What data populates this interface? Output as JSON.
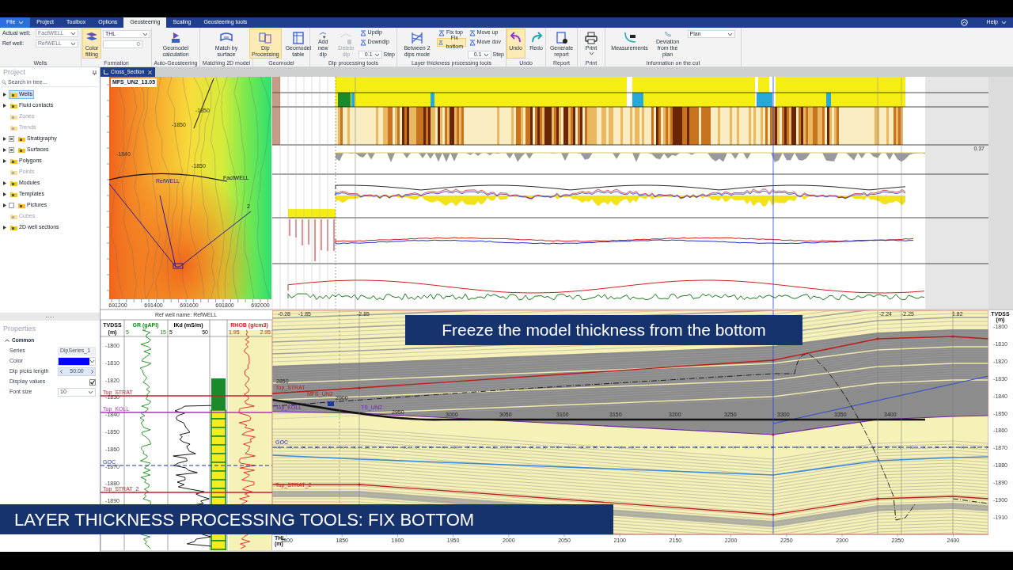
{
  "window": {
    "file_menu": "File",
    "help_menu": "Help"
  },
  "ribbon_tabs": [
    {
      "label": "Project",
      "selected": false
    },
    {
      "label": "Toolbox",
      "selected": false
    },
    {
      "label": "Options",
      "selected": false
    },
    {
      "label": "Geosteering",
      "selected": true
    },
    {
      "label": "Scaling",
      "selected": false
    },
    {
      "label": "Geosteering tools",
      "selected": false
    }
  ],
  "ribbon_groups": [
    {
      "title": "Wells",
      "items": [
        {
          "kind": "stack",
          "items": [
            {
              "kind": "combo",
              "label": "Actual well:",
              "value": "FactWELL"
            },
            {
              "kind": "combo",
              "label": "Ref well:",
              "value": "RefWELL"
            }
          ]
        }
      ]
    },
    {
      "title": "Formation",
      "items": [
        {
          "kind": "large",
          "label": "Color filling",
          "selected": true,
          "disabled": false
        },
        {
          "kind": "stack",
          "items": [
            {
              "kind": "dropdown",
              "value": "THL"
            },
            {
              "kind": "spin",
              "placeholder": "0"
            }
          ]
        }
      ]
    },
    {
      "title": "Auto-Geosteering",
      "items": [
        {
          "kind": "large",
          "label": "Geomodel calculation",
          "selected": false,
          "disabled": false
        }
      ]
    },
    {
      "title": "Matching 2D model",
      "items": [
        {
          "kind": "large",
          "label": "Match by surface",
          "selected": false,
          "disabled": false
        }
      ]
    },
    {
      "title": "Geomodel",
      "items": [
        {
          "kind": "large",
          "label": "Dip Processing",
          "selected": true,
          "disabled": false
        },
        {
          "kind": "large",
          "label": "Geomodel table",
          "selected": false,
          "disabled": false
        }
      ]
    },
    {
      "title": "Dip processing tools",
      "items": [
        {
          "kind": "large",
          "label": "Add new dip",
          "selected": false,
          "disabled": false
        },
        {
          "kind": "large",
          "label": "Delete dip",
          "selected": false,
          "disabled": true
        },
        {
          "kind": "stack",
          "items": [
            {
              "kind": "small",
              "label": "Updip",
              "selected": false
            },
            {
              "kind": "small",
              "label": "Downdip",
              "selected": false
            },
            {
              "kind": "step",
              "value": "0.1",
              "label": "Step"
            }
          ]
        }
      ]
    },
    {
      "title": "Layer thickness processing tools",
      "items": [
        {
          "kind": "large",
          "label": "Between 2 dips mode",
          "selected": false,
          "disabled": false
        },
        {
          "kind": "stack",
          "items": [
            {
              "kind": "small",
              "label": "Fix top",
              "selected": false
            },
            {
              "kind": "small",
              "label": "Fix bottom",
              "selected": true
            }
          ]
        },
        {
          "kind": "stack",
          "items": [
            {
              "kind": "small",
              "label": "Move up",
              "selected": false
            },
            {
              "kind": "small",
              "label": "Move dov",
              "selected": false
            },
            {
              "kind": "step",
              "value": "0.1",
              "label": "Step"
            }
          ]
        }
      ]
    },
    {
      "title": "Undo",
      "items": [
        {
          "kind": "large",
          "label": "Undo",
          "selected": true,
          "disabled": false
        },
        {
          "kind": "large",
          "label": "Redo",
          "selected": false,
          "disabled": false
        }
      ]
    },
    {
      "title": "Report",
      "items": [
        {
          "kind": "large",
          "label": "Generate report",
          "selected": false,
          "disabled": false
        }
      ]
    },
    {
      "title": "Print",
      "items": [
        {
          "kind": "menu",
          "label": "Print",
          "selected": false,
          "disabled": false
        }
      ]
    },
    {
      "title": "Information on the cut",
      "items": [
        {
          "kind": "large",
          "label": "Measurements",
          "selected": false,
          "disabled": false
        },
        {
          "kind": "large",
          "label": "Deviation from the plan",
          "selected": false,
          "disabled": false
        },
        {
          "kind": "dropdown",
          "value": "Plan"
        }
      ]
    }
  ],
  "project_panel": {
    "title": "Project",
    "search": {
      "placeholder": "Search in tree..."
    },
    "items": [
      {
        "kind": "folder",
        "label": "Wells",
        "selected": true,
        "expandable": true,
        "disabled": false
      },
      {
        "kind": "folder",
        "label": "Fluid contacts",
        "selected": false,
        "expandable": true,
        "disabled": false
      },
      {
        "kind": "folder",
        "label": "Zones",
        "selected": false,
        "expandable": false,
        "disabled": true
      },
      {
        "kind": "folder",
        "label": "Trends",
        "selected": false,
        "expandable": false,
        "disabled": true
      },
      {
        "kind": "partial",
        "label": "Stratigraphy",
        "selected": false,
        "expandable": true,
        "disabled": false
      },
      {
        "kind": "partial",
        "label": "Surfaces",
        "selected": false,
        "expandable": true,
        "disabled": false
      },
      {
        "kind": "folder",
        "label": "Polygons",
        "selected": false,
        "expandable": true,
        "disabled": false
      },
      {
        "kind": "folder",
        "label": "Points",
        "selected": false,
        "expandable": false,
        "disabled": true
      },
      {
        "kind": "folder",
        "label": "Modules",
        "selected": false,
        "expandable": true,
        "disabled": false
      },
      {
        "kind": "folder",
        "label": "Templates",
        "selected": false,
        "expandable": true,
        "disabled": false
      },
      {
        "kind": "unchecked",
        "label": "Pictures",
        "selected": false,
        "expandable": true,
        "disabled": false
      },
      {
        "kind": "folder",
        "label": "Cubes",
        "selected": false,
        "expandable": false,
        "disabled": true
      },
      {
        "kind": "folder",
        "label": "2D well sections",
        "selected": false,
        "expandable": true,
        "disabled": false
      }
    ]
  },
  "properties_panel": {
    "title": "Properties",
    "section": "Common",
    "expanded": true,
    "rows": [
      {
        "kind": "text",
        "label": "Series",
        "value": "DipSeries_1"
      },
      {
        "kind": "color",
        "label": "Color",
        "color": "#0000ff"
      },
      {
        "kind": "spin",
        "label": "Dip picks length",
        "value": "50.00"
      },
      {
        "kind": "checkbox",
        "label": "Display values",
        "checked": true
      },
      {
        "kind": "dropdown",
        "label": "Font size",
        "value": "10"
      }
    ]
  },
  "document_tabs": [
    {
      "label": "Cross_Section",
      "selected": true
    }
  ],
  "map": {
    "title": "MFS_UN2_13.05",
    "well_labels": [
      "RefWELL",
      "FactWELL",
      "2"
    ],
    "contour_labels": [
      "-1850",
      "-1850",
      "-1840",
      "-1850"
    ],
    "x_axis_labels": [
      "691200",
      "691400",
      "691600",
      "691800",
      "692000"
    ]
  },
  "log_tracks": {
    "value_label": "0.37"
  },
  "ref_log": {
    "title": "Ref well name: RefWELL",
    "depth_title": "TVDSS",
    "depth_unit": "(m)",
    "tracks": [
      {
        "min": "5",
        "name": "GR (gAPI)",
        "max": "15",
        "color": "#1a8a1a"
      },
      {
        "min": "5",
        "name": "IKd (mS/m)",
        "max": "50",
        "color": "#000000"
      },
      {
        "min": "1.95",
        "name": "RHOB (g/cm3)",
        "max": "2.95",
        "color": "#e02020"
      }
    ],
    "depths": [
      "-1800",
      "-1810",
      "-1820",
      "-1830",
      "-1840",
      "-1850",
      "-1860",
      "-1870",
      "-1880",
      "-1890"
    ],
    "tops": [
      "Top_STRAT",
      "Top_KOLL",
      "GOC",
      "Top_STRAT_2"
    ]
  },
  "cross_section": {
    "dip_labels": [
      "-0.28",
      "-1.85",
      "-2.85",
      "-2.24",
      "-2.25",
      "1.82"
    ],
    "horizon_labels": [
      "Top_STRAT",
      "MFS_UN2",
      "Top_KOLL",
      "TS_UN2",
      "GOC",
      "Top_STRAT_2"
    ],
    "md_labels": [
      "2850",
      "2900",
      "2950",
      "3000",
      "3050",
      "3100",
      "3150",
      "3200",
      "3250",
      "3300",
      "3350",
      "3400"
    ],
    "depth_axis": {
      "title": "TVDSS",
      "unit": "(m)",
      "labels": [
        "-1800",
        "-1810",
        "-1820",
        "-1830",
        "-1840",
        "-1850",
        "-1860",
        "-1870",
        "-1880",
        "-1890",
        "-1900",
        "-1910"
      ]
    },
    "thl_axis": {
      "title": "THL",
      "unit": "(m)",
      "labels": [
        "1800",
        "1850",
        "1900",
        "1950",
        "2000",
        "2050",
        "2100",
        "2150",
        "2200",
        "2250",
        "2300",
        "2350",
        "2400"
      ]
    }
  },
  "caption": "Freeze the model thickness from the bottom",
  "banner": "LAYER THICKNESS PROCESSING TOOLS: FIX BOTTOM"
}
